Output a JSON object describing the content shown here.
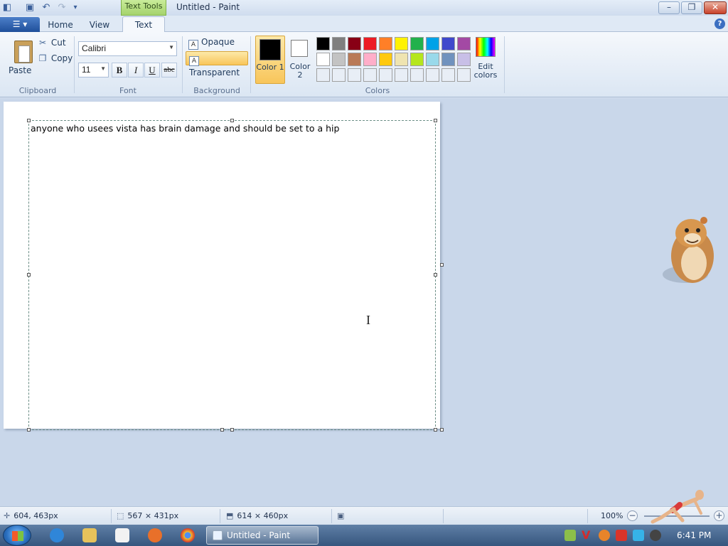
{
  "window": {
    "title": "Untitled - Paint",
    "contextual_tab": "Text Tools"
  },
  "tabs": [
    {
      "label": "Home"
    },
    {
      "label": "View"
    },
    {
      "label": "Text"
    }
  ],
  "clipboard": {
    "paste": "Paste",
    "cut": "Cut",
    "copy": "Copy",
    "group": "Clipboard"
  },
  "font": {
    "family": "Calibri",
    "size": "11",
    "bold": "B",
    "italic": "I",
    "underline": "U",
    "strike": "abc",
    "group": "Font"
  },
  "background": {
    "opaque": "Opaque",
    "transparent": "Transparent",
    "group": "Background"
  },
  "colors": {
    "color1_label": "Color 1",
    "color2_label": "Color 2",
    "color1": "#000000",
    "color2": "#ffffff",
    "edit": "Edit colors",
    "group": "Colors",
    "palette_row1": [
      "#000000",
      "#7f7f7f",
      "#880015",
      "#ed1c24",
      "#ff7f27",
      "#fff200",
      "#22b14c",
      "#00a2e8",
      "#3f48cc",
      "#a349a4"
    ],
    "palette_row2": [
      "#ffffff",
      "#c3c3c3",
      "#b97a57",
      "#ffaec9",
      "#ffc90e",
      "#efe4b0",
      "#b5e61d",
      "#99d9ea",
      "#7092be",
      "#c8bfe7"
    ],
    "palette_row3": [
      "#e8eef6",
      "#e8eef6",
      "#e8eef6",
      "#e8eef6",
      "#e8eef6",
      "#e8eef6",
      "#e8eef6",
      "#e8eef6",
      "#e8eef6",
      "#e8eef6"
    ]
  },
  "canvas": {
    "text": "anyone who usees vista has brain damage and should be set to a hip"
  },
  "status": {
    "cursor_pos": "604, 463px",
    "selection_size": "567 × 431px",
    "image_size": "614 × 460px",
    "zoom": "100%"
  },
  "taskbar": {
    "task_label": "Untitled - Paint",
    "clock": "6:41 PM"
  }
}
